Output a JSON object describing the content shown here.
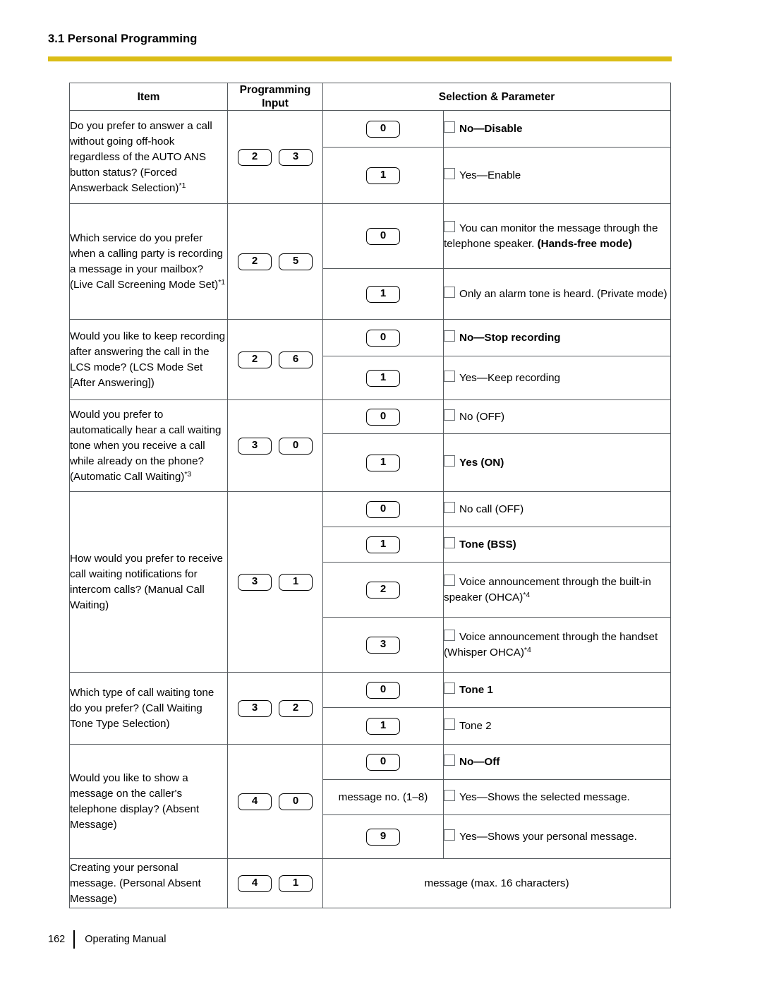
{
  "header": {
    "section_title": "3.1 Personal Programming"
  },
  "table": {
    "columns": [
      "Item",
      "Programming Input",
      "Selection & Parameter"
    ],
    "col_item": "Item",
    "col_input_line1": "Programming",
    "col_input_line2": "Input",
    "col_selection": "Selection & Parameter",
    "rows": [
      {
        "item": "Do you prefer to answer a call without going off-hook regardless of the AUTO ANS button status? (Forced Answerback Selection)",
        "item_footnote": "*1",
        "input_keys": [
          "2",
          "3"
        ],
        "options": [
          {
            "key": "0",
            "label": "No—Disable",
            "bold": true
          },
          {
            "key": "1",
            "label": "Yes—Enable",
            "bold": false
          }
        ]
      },
      {
        "item": "Which service do you prefer when a calling party is recording a message in your mailbox? (Live Call Screening Mode Set)",
        "item_footnote": "*1",
        "input_keys": [
          "2",
          "5"
        ],
        "options": [
          {
            "key": "0",
            "label": "You can monitor the message through the telephone speaker. ",
            "label_bold_tail": "(Hands-free mode)",
            "bold": false
          },
          {
            "key": "1",
            "label": "Only an alarm tone is heard. (Private mode)",
            "bold": false
          }
        ]
      },
      {
        "item": "Would you like to keep recording after answering the call in the LCS mode? (LCS Mode Set [After Answering])",
        "item_footnote": "",
        "input_keys": [
          "2",
          "6"
        ],
        "options": [
          {
            "key": "0",
            "label": "No—Stop recording",
            "bold": true
          },
          {
            "key": "1",
            "label": "Yes—Keep recording",
            "bold": false
          }
        ]
      },
      {
        "item": "Would you prefer to automatically hear a call waiting tone when you receive a call while already on the phone? (Automatic Call Waiting)",
        "item_footnote": "*3",
        "input_keys": [
          "3",
          "0"
        ],
        "options": [
          {
            "key": "0",
            "label": "No (OFF)",
            "bold": false
          },
          {
            "key": "1",
            "label": "Yes (ON)",
            "bold": true
          }
        ]
      },
      {
        "item": "How would you prefer to receive call waiting notifications for intercom calls? (Manual Call Waiting)",
        "item_footnote": "",
        "input_keys": [
          "3",
          "1"
        ],
        "options": [
          {
            "key": "0",
            "label": "No call (OFF)",
            "bold": false
          },
          {
            "key": "1",
            "label": "Tone (BSS)",
            "bold": true
          },
          {
            "key": "2",
            "label": "Voice announcement through the built-in speaker (OHCA)",
            "footnote": "*4",
            "bold": false
          },
          {
            "key": "3",
            "label": "Voice announcement through the handset (Whisper OHCA)",
            "footnote": "*4",
            "bold": false
          }
        ]
      },
      {
        "item": "Which type of call waiting tone do you prefer? (Call Waiting Tone Type Selection)",
        "item_footnote": "",
        "input_keys": [
          "3",
          "2"
        ],
        "options": [
          {
            "key": "0",
            "label": "Tone 1",
            "bold": true
          },
          {
            "key": "1",
            "label": "Tone 2",
            "bold": false
          }
        ]
      },
      {
        "item": "Would you like to show a message on the caller's telephone display? (Absent Message)",
        "item_footnote": "",
        "input_keys": [
          "4",
          "0"
        ],
        "options": [
          {
            "key": "0",
            "label": "No—Off",
            "bold": true
          },
          {
            "key_text": "message no. (1–8)",
            "label": "Yes—Shows the selected message.",
            "bold": false
          },
          {
            "key": "9",
            "label": "Yes—Shows your personal message.",
            "bold": false
          }
        ]
      },
      {
        "item": "Creating your personal message. (Personal Absent Message)",
        "item_footnote": "",
        "input_keys": [
          "4",
          "1"
        ],
        "span_param": "message (max. 16 characters)"
      }
    ]
  },
  "footer": {
    "page_number": "162",
    "manual_title": "Operating Manual"
  },
  "colors": {
    "accent_bar": "#dbbd16",
    "table_border": "#555a5e",
    "checkbox_border": "#6a6f73"
  }
}
